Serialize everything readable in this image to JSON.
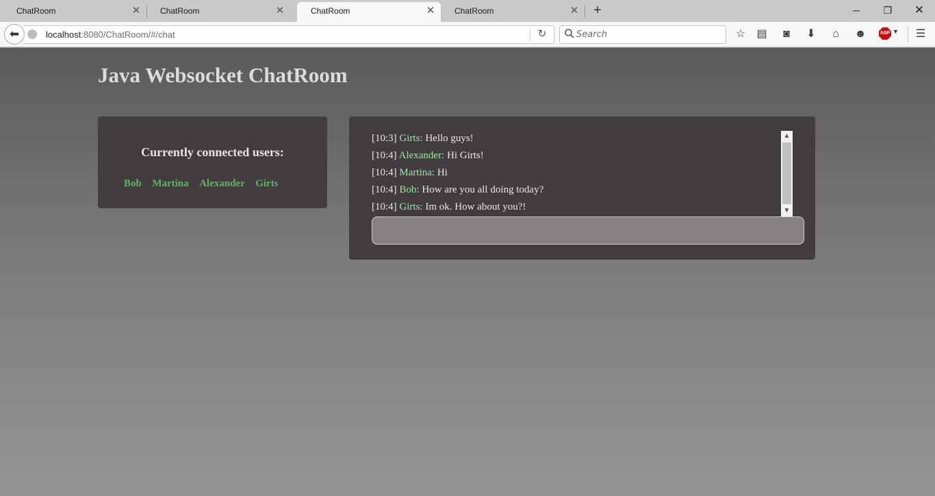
{
  "browser": {
    "tabs": [
      {
        "label": "ChatRoom",
        "active": false
      },
      {
        "label": "ChatRoom",
        "active": false
      },
      {
        "label": "ChatRoom",
        "active": true
      },
      {
        "label": "ChatRoom",
        "active": false
      }
    ],
    "url": {
      "host": "localhost",
      "path": ":8080/ChatRoom/#/chat"
    },
    "search": {
      "placeholder": "Search",
      "value": ""
    },
    "toolbar_icons": [
      "bookmark-star-icon",
      "reading-list-icon",
      "pocket-icon",
      "download-icon",
      "home-icon",
      "hello-icon",
      "adblock-plus-icon",
      "menu-icon"
    ],
    "adblock": {
      "badge": "ABP",
      "color": "#c70d0d"
    }
  },
  "page": {
    "title": "Java Websocket ChatRoom",
    "users_panel": {
      "heading": "Currently connected users:",
      "users": [
        "Bob",
        "Martina",
        "Alexander",
        "Girts"
      ],
      "user_color": "#5cb85c"
    },
    "chat": {
      "messages": [
        {
          "time": "[10:3]",
          "user": "Girts",
          "text": "Hello guys!"
        },
        {
          "time": "[10:4]",
          "user": "Alexander",
          "text": "Hi Girts!"
        },
        {
          "time": "[10:4]",
          "user": "Martina",
          "text": "Hi"
        },
        {
          "time": "[10:4]",
          "user": "Bob",
          "text": "How are you all doing today?"
        },
        {
          "time": "[10:4]",
          "user": "Girts",
          "text": "Im ok. How about you?!"
        }
      ],
      "input_value": "",
      "panel_color": "#423c41",
      "username_color": "#9ee89e"
    }
  }
}
